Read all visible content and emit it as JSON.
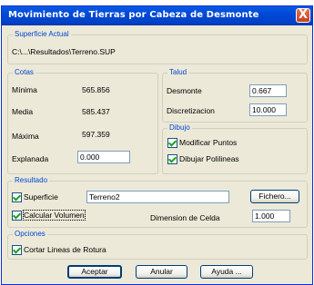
{
  "window": {
    "title": "Movimiento de Tierras por Cabeza de Desmonte",
    "close_glyph": "X"
  },
  "superficie_actual": {
    "legend": "Superficie Actual",
    "path": "C:\\...\\Resultados\\Terreno.SUP"
  },
  "cotas": {
    "legend": "Cotas",
    "minima_label": "Mínima",
    "minima_value": "565.856",
    "media_label": "Media",
    "media_value": "585.437",
    "maxima_label": "Máxima",
    "maxima_value": "597.359",
    "explanada_label": "Explanada",
    "explanada_value": "0.000"
  },
  "talud": {
    "legend": "Talud",
    "desmonte_label": "Desmonte",
    "desmonte_value": "0.667",
    "discretizacion_label": "Discretizacion",
    "discretizacion_value": "10.000"
  },
  "dibujo": {
    "legend": "Dibujo",
    "modificar_label": "Modificar Puntos",
    "modificar_checked": true,
    "polilineas_label": "Dibujar Polilineas",
    "polilineas_checked": true
  },
  "resultado": {
    "legend": "Resultado",
    "superficie_label": "Superficie",
    "superficie_checked": true,
    "superficie_value": "Terreno2",
    "fichero_label": "Fichero...",
    "calcular_label": "Calcular Volumen",
    "calcular_checked": true,
    "celda_label": "Dimension de Celda",
    "celda_value": "1.000"
  },
  "opciones": {
    "legend": "Opciones",
    "cortar_label": "Cortar Lineas de Rotura",
    "cortar_checked": true
  },
  "buttons": {
    "aceptar": "Aceptar",
    "anular": "Anular",
    "ayuda": "Ayuda ..."
  }
}
